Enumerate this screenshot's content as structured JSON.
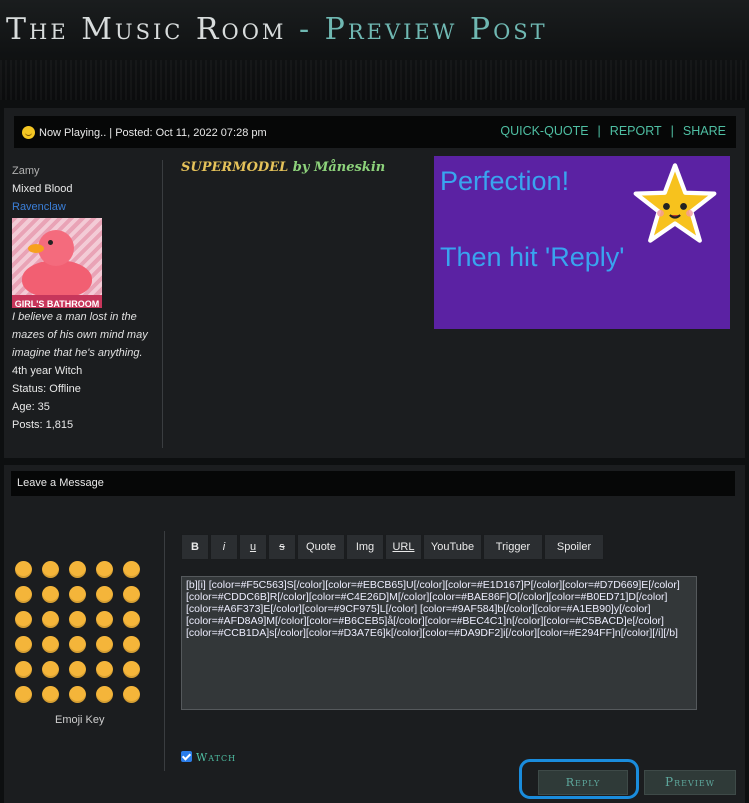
{
  "site": {
    "title": "The Music Room",
    "separator": " - ",
    "subtitle": "Preview Post"
  },
  "post": {
    "meta": "Now Playing.. | Posted: Oct 11, 2022 07:28 pm",
    "actions": [
      "QUICK-QUOTE",
      "REPORT",
      "SHARE"
    ],
    "song_title": "SUPERMODEL",
    "song_by": "by Måneskin",
    "banner": {
      "line1": "Perfection!",
      "line2": "Then hit 'Reply'",
      "bg_color": "#5b22a3",
      "text_color": "#39a4ef"
    }
  },
  "profile": {
    "username": "Zamy",
    "group": "Mixed Blood",
    "house": "Ravenclaw",
    "avatar_caption": "GIRL'S BATHROOM",
    "quote": "I believe a man lost in the mazes of his own mind may imagine that he's anything.",
    "year": "4th year Witch",
    "status": "Status: Offline",
    "age": "Age: 35",
    "posts": "Posts: 1,815"
  },
  "reply": {
    "section_title": "Leave a Message",
    "emoji_key_label": "Emoji Key",
    "toolbar": [
      "B",
      "i",
      "u",
      "s",
      "Quote",
      "Img",
      "URL",
      "YouTube",
      "Trigger",
      "Spoiler"
    ],
    "editor_value": "[b][i] [color=#F5C563]S[/color][color=#EBCB65]U[/color][color=#E1D167]P[/color][color=#D7D669]E[/color][color=#CDDC6B]R[/color][color=#C4E26D]M[/color][color=#BAE86F]O[/color][color=#B0ED71]D[/color][color=#A6F373]E[/color][color=#9CF975]L[/color] [color=#9AF584]b[/color][color=#A1EB90]y[/color][color=#AFD8A9]M[/color][color=#B6CEB5]å[/color][color=#BEC4C1]n[/color][color=#C5BACD]e[/color][color=#CCB1DA]s[/color][color=#D3A7E6]k[/color][color=#DA9DF2]i[/color][color=#E294FF]n[/color][/i][/b]",
    "watch_label": "Watch",
    "reply_label": "Reply",
    "preview_label": "Preview"
  },
  "colors": {
    "accent": "#4fbfa3",
    "highlight_ring": "#1a8cdc"
  }
}
